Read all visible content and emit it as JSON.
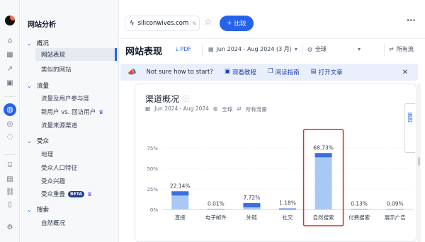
{
  "sidebar": {
    "title": "网站分析",
    "groups": [
      {
        "label": "概况",
        "items": [
          {
            "label": "网站表现"
          },
          {
            "label": "类似的网站"
          }
        ]
      },
      {
        "label": "流量",
        "items": [
          {
            "label": "流量及用户参与度"
          },
          {
            "label": "新用户 vs. 回访用户"
          },
          {
            "label": "流量来源渠道"
          }
        ]
      },
      {
        "label": "受众",
        "items": [
          {
            "label": "地理"
          },
          {
            "label": "受众人口特征"
          },
          {
            "label": "受众兴趣"
          },
          {
            "label": "受众重叠",
            "badge": "BETA"
          }
        ]
      },
      {
        "label": "搜索",
        "items": [
          {
            "label": "自然概况"
          }
        ]
      }
    ]
  },
  "topbar": {
    "domain": "siliconwives.com",
    "compare_label": "比较",
    "more": "···"
  },
  "header": {
    "title": "网站表现",
    "pdf_label": "PDF",
    "date_range": "Jun 2024 - Aug 2024 (3 月)",
    "geo": "全球",
    "traffic": "所有流"
  },
  "banner": {
    "text": "Not sure how to start?",
    "links": [
      "观看教程",
      "阅读指南",
      "打开文章"
    ]
  },
  "card": {
    "title": "渠道概况",
    "date_range": "Jun 2024 - Aug 2024",
    "geo": "全球",
    "traffic": "所有流量",
    "side_tab": "跟踪"
  },
  "chart_data": {
    "type": "bar",
    "title": "渠道概况",
    "categories": [
      "直接",
      "电子邮件",
      "外链",
      "社交",
      "自然搜索",
      "付费搜索",
      "展示广告"
    ],
    "values": [
      22.14,
      0.01,
      7.72,
      1.18,
      68.73,
      0.13,
      0.09
    ],
    "value_labels": [
      "22.14%",
      "0.01%",
      "7.72%",
      "1.18%",
      "68.73%",
      "0.13%",
      "0.09%"
    ],
    "yticks": [
      "0%",
      "25%",
      "50%",
      "75%"
    ],
    "ylim": [
      0,
      75
    ],
    "highlight_category": "自然搜索",
    "colors": {
      "bar": "#a9c8f5",
      "bar_top": "#3b6fe0",
      "highlight_box": "#d62e2e"
    }
  }
}
